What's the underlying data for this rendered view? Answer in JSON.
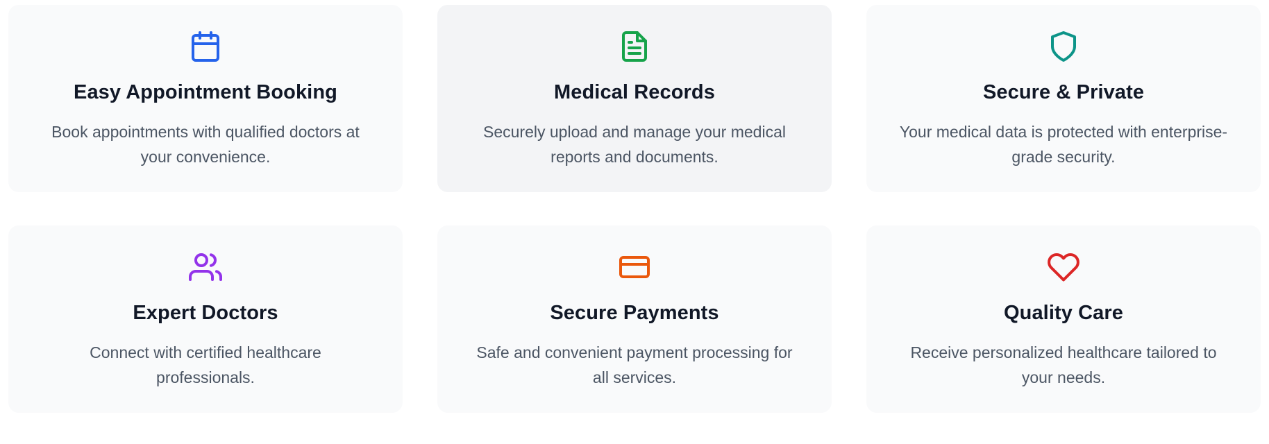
{
  "features": [
    {
      "icon": "calendar-icon",
      "icon_color": "#2563eb",
      "title": "Easy Appointment Booking",
      "description": "Book appointments with qualified doctors at your convenience."
    },
    {
      "icon": "document-icon",
      "icon_color": "#16a34a",
      "title": "Medical Records",
      "description": "Securely upload and manage your medical reports and documents."
    },
    {
      "icon": "shield-icon",
      "icon_color": "#0d9488",
      "title": "Secure & Private",
      "description": "Your medical data is protected with enterprise-grade security."
    },
    {
      "icon": "users-icon",
      "icon_color": "#9333ea",
      "title": "Expert Doctors",
      "description": "Connect with certified healthcare professionals."
    },
    {
      "icon": "credit-card-icon",
      "icon_color": "#ea580c",
      "title": "Secure Payments",
      "description": "Safe and convenient payment processing for all services."
    },
    {
      "icon": "heart-icon",
      "icon_color": "#dc2626",
      "title": "Quality Care",
      "description": "Receive personalized healthcare tailored to your needs."
    }
  ],
  "colors": {
    "card_background": "#f9fafb",
    "card_background_hover": "#f3f4f6",
    "title_text": "#111827",
    "description_text": "#4b5563"
  }
}
